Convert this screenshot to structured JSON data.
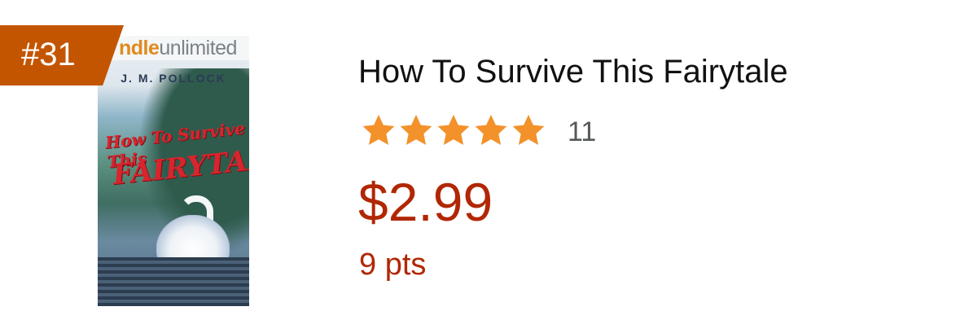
{
  "product": {
    "rank": "#31",
    "cover": {
      "program_logo_part1": "ndle",
      "program_logo_part2": "unlimited",
      "author": "J. M. POLLOCK",
      "title_line1": "How To Survive This",
      "title_line2": "FAIRYTALE"
    },
    "title": "How To Survive This Fairytale",
    "rating": {
      "stars": 5,
      "max_stars": 5,
      "count": "11",
      "star_color": "#f3912a"
    },
    "price": "$2.99",
    "points": "9 pts"
  },
  "colors": {
    "rank_badge": "#c45500",
    "price": "#b12704",
    "title": "#111111",
    "count": "#565959"
  }
}
